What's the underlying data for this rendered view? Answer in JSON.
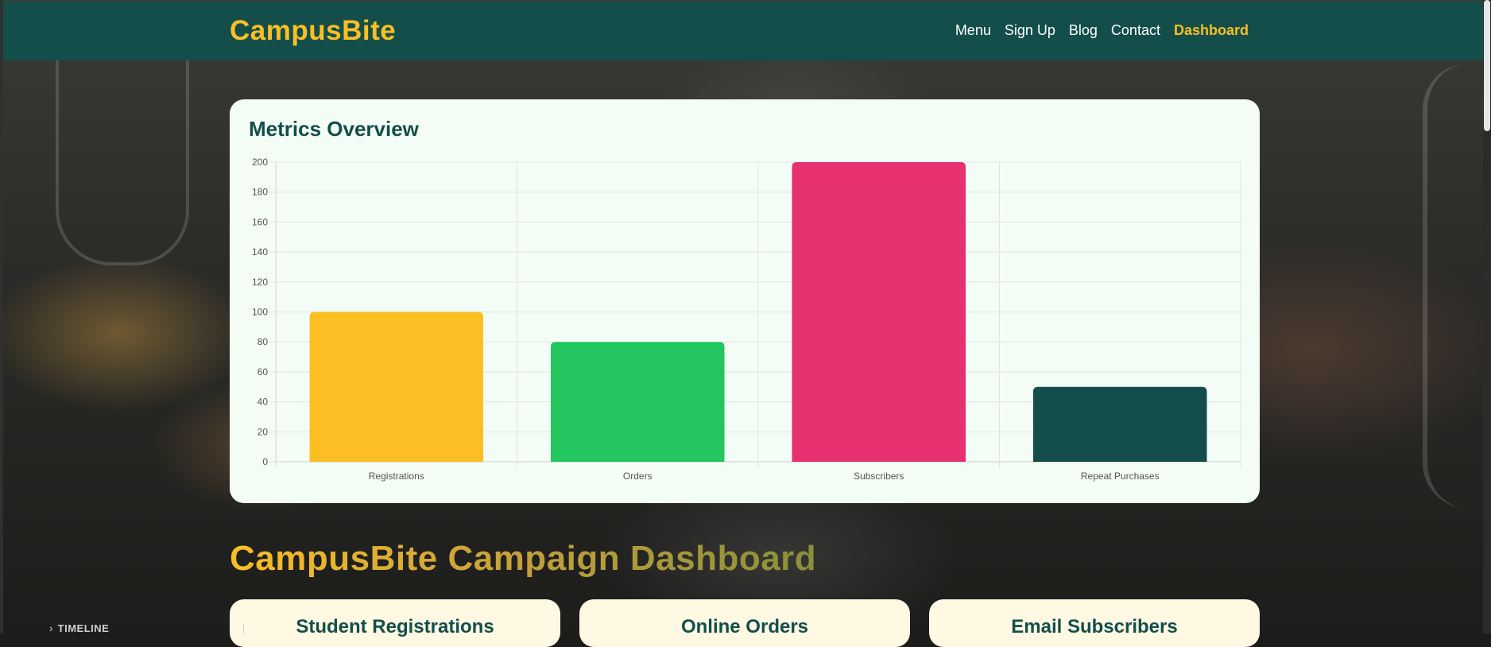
{
  "brand": "CampusBite",
  "nav": [
    "Menu",
    "Sign Up",
    "Blog",
    "Contact",
    "Dashboard"
  ],
  "nav_active": "Dashboard",
  "metrics_card": {
    "title": "Metrics Overview"
  },
  "chart_data": {
    "type": "bar",
    "categories": [
      "Registrations",
      "Orders",
      "Subscribers",
      "Repeat Purchases"
    ],
    "values": [
      100,
      80,
      200,
      50
    ],
    "colors": [
      "#fbbf24",
      "#22c55e",
      "#e6306f",
      "#134e4a"
    ],
    "ylim": [
      0,
      200
    ],
    "yticks": [
      0,
      20,
      40,
      60,
      80,
      100,
      120,
      140,
      160,
      180,
      200
    ],
    "grid": true
  },
  "dashboard_title": "CampusBite Campaign Dashboard",
  "stat_cards": [
    "Student Registrations",
    "Online Orders",
    "Email Subscribers"
  ],
  "timeline_label": "TIMELINE",
  "colors": {
    "header": "#134e4a",
    "accent": "#fbbf24",
    "card_bg": "#f3fdf6"
  }
}
